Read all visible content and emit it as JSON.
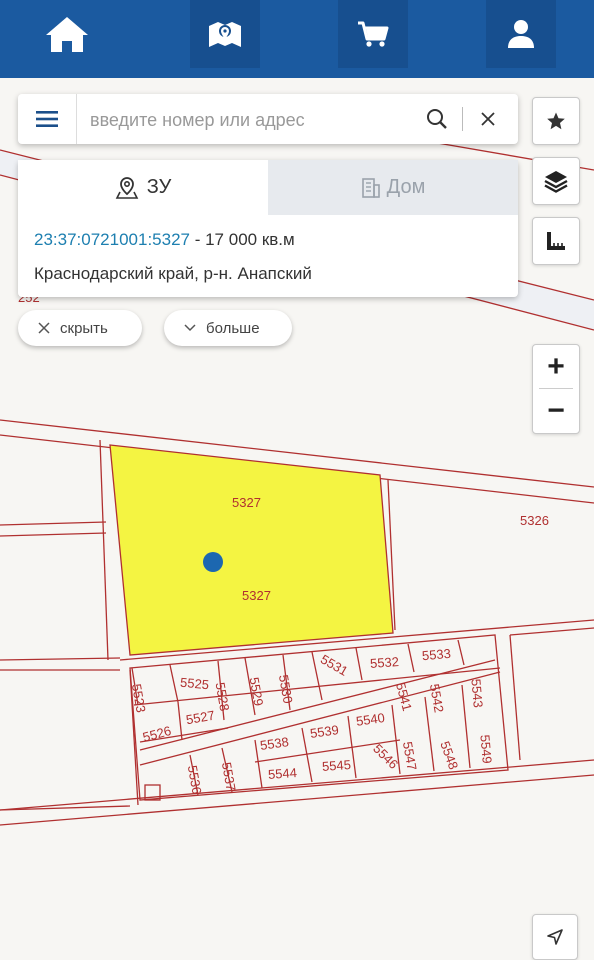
{
  "topbar": {
    "items": [
      {
        "name": "home",
        "icon": "home-icon"
      },
      {
        "name": "map",
        "icon": "map-pin-icon"
      },
      {
        "name": "cart",
        "icon": "cart-icon"
      },
      {
        "name": "profile",
        "icon": "user-icon"
      }
    ],
    "bg_color": "#1b5aa0"
  },
  "search": {
    "placeholder": "введите номер или адрес"
  },
  "info_card": {
    "tabs": [
      {
        "label": "ЗУ",
        "icon": "location-icon",
        "active": true
      },
      {
        "label": "Дом",
        "icon": "building-icon",
        "active": false
      }
    ],
    "cadastral_number": "23:37:0721001:5327",
    "area_text": " - 17 000 кв.м",
    "address": "Краснодарский край, р-н. Анапский"
  },
  "actions": {
    "hide_label": "скрыть",
    "more_label": "больше"
  },
  "controls": {
    "zoom_in": "+",
    "zoom_out": "−"
  },
  "map": {
    "selected_parcel_color": "#f4f442",
    "boundary_color": "#b03030",
    "partial_label": "252",
    "labels": {
      "parcel_5327_a": "5327",
      "parcel_5327_b": "5327",
      "p5326": "5326",
      "p5523": "5523",
      "p5525": "5525",
      "p5528": "5528",
      "p5529": "5529",
      "p5530": "5530",
      "p5531": "5531",
      "p5532": "5532",
      "p5533": "5533",
      "p5526": "5526",
      "p5527": "5527",
      "p5536": "5536",
      "p5537": "5537",
      "p5538": "5538",
      "p5539": "5539",
      "p5540": "5540",
      "p5541": "5541",
      "p5542": "5542",
      "p5543": "5543",
      "p5544": "5544",
      "p5545": "5545",
      "p5546": "5546",
      "p5547": "5547",
      "p5548": "5548",
      "p5549": "5549"
    }
  }
}
